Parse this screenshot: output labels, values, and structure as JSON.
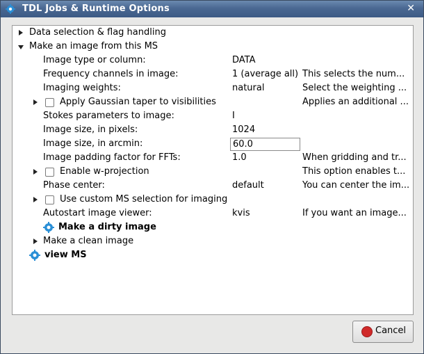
{
  "window": {
    "title": "TDL Jobs & Runtime Options",
    "close_glyph": "✕"
  },
  "tree": {
    "data_selection": "Data selection & flag handling",
    "make_image": "Make an image from this MS",
    "rows": [
      {
        "label": "Image type or column:",
        "value": "DATA",
        "desc": ""
      },
      {
        "label": "Frequency channels in image:",
        "value": "1 (average all)",
        "desc": "This selects the num..."
      },
      {
        "label": "Imaging weights:",
        "value": "natural",
        "desc": "Select the weighting ..."
      },
      {
        "label": "Apply Gaussian taper to visibilities",
        "value": "",
        "desc": "Applies an additional ..."
      },
      {
        "label": "Stokes parameters to image:",
        "value": "I",
        "desc": ""
      },
      {
        "label": "Image size, in pixels:",
        "value": "1024",
        "desc": ""
      },
      {
        "label": "Image size, in arcmin:",
        "value": "60.0",
        "desc": ""
      },
      {
        "label": "Image padding factor for FFTs:",
        "value": "1.0",
        "desc": "When gridding and tr..."
      },
      {
        "label": "Enable w-projection",
        "value": "",
        "desc": "This option enables t..."
      },
      {
        "label": "Phase center:",
        "value": "default",
        "desc": "You can center the im..."
      },
      {
        "label": "Use custom MS selection for imaging",
        "value": "",
        "desc": ""
      },
      {
        "label": "Autostart image viewer:",
        "value": "kvis",
        "desc": "If you want an image..."
      }
    ],
    "dirty_image": "Make a dirty image",
    "clean_image": "Make a clean image",
    "view_ms": "view MS"
  },
  "buttons": {
    "cancel": "Cancel"
  },
  "colors": {
    "title_bg": "#4a6892",
    "gear": "#2a8fd6",
    "cancel_icon": "#d02a2a"
  }
}
